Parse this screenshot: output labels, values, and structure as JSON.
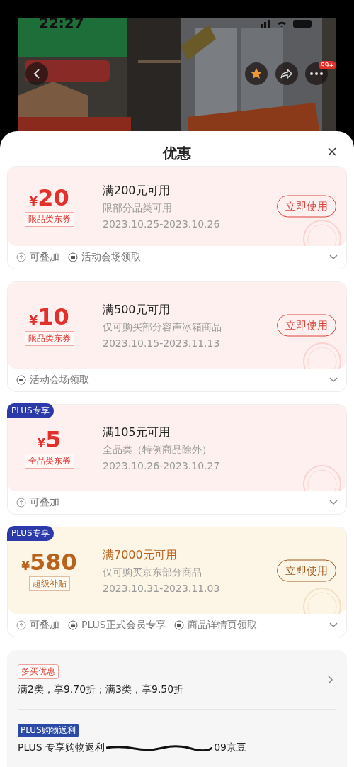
{
  "status_bar": {
    "time": "22:27"
  },
  "top_bar": {
    "more_badge": "99+"
  },
  "sheet": {
    "title": "优惠",
    "coupons": [
      {
        "kind": "red",
        "currency": "¥",
        "amount": "20",
        "type_label": "限品类东券",
        "condition": "满200元可用",
        "scope": "限部分品类可用",
        "validity": "2023.10.25-2023.10.26",
        "button": "立即使用",
        "claimed": true,
        "tags": [
          {
            "kind": "stack",
            "text": "可叠加"
          },
          {
            "kind": "venue",
            "text": "活动会场领取"
          }
        ]
      },
      {
        "kind": "red",
        "currency": "¥",
        "amount": "10",
        "type_label": "限品类东券",
        "condition": "满500元可用",
        "scope": "仅可购买部分容声冰箱商品",
        "validity": "2023.10.15-2023.11.13",
        "button": "立即使用",
        "claimed": true,
        "tags": [
          {
            "kind": "venue",
            "text": "活动会场领取"
          }
        ]
      },
      {
        "kind": "red",
        "plus_badge": "PLUS专享",
        "currency": "¥",
        "amount": "5",
        "type_label": "全品类东券",
        "condition": "满105元可用",
        "scope": "全品类（特例商品除外）",
        "validity": "2023.10.26-2023.10.27",
        "claimed": true,
        "tags": [
          {
            "kind": "stack",
            "text": "可叠加"
          }
        ]
      },
      {
        "kind": "gold",
        "plus_badge": "PLUS专享",
        "currency": "¥",
        "amount": "580",
        "type_label": "超级补贴",
        "condition": "满7000元可用",
        "scope": "仅可购买京东部分商品",
        "validity": "2023.10.31-2023.11.03",
        "button": "立即使用",
        "claimed": true,
        "tags": [
          {
            "kind": "stack",
            "text": "可叠加"
          },
          {
            "kind": "crown",
            "text": "PLUS正式会员专享"
          },
          {
            "kind": "venue",
            "text": "商品详情页领取"
          }
        ]
      }
    ],
    "promotions": [
      {
        "kind": "red",
        "badge": "多买优惠",
        "text": "满2类，享9.70折；满3类，享9.50折",
        "arrow": true
      },
      {
        "kind": "plus",
        "badge": "PLUS购物返利",
        "text": "PLUS 专享购物返利",
        "tail": "09京豆",
        "arrow": false
      }
    ]
  }
}
